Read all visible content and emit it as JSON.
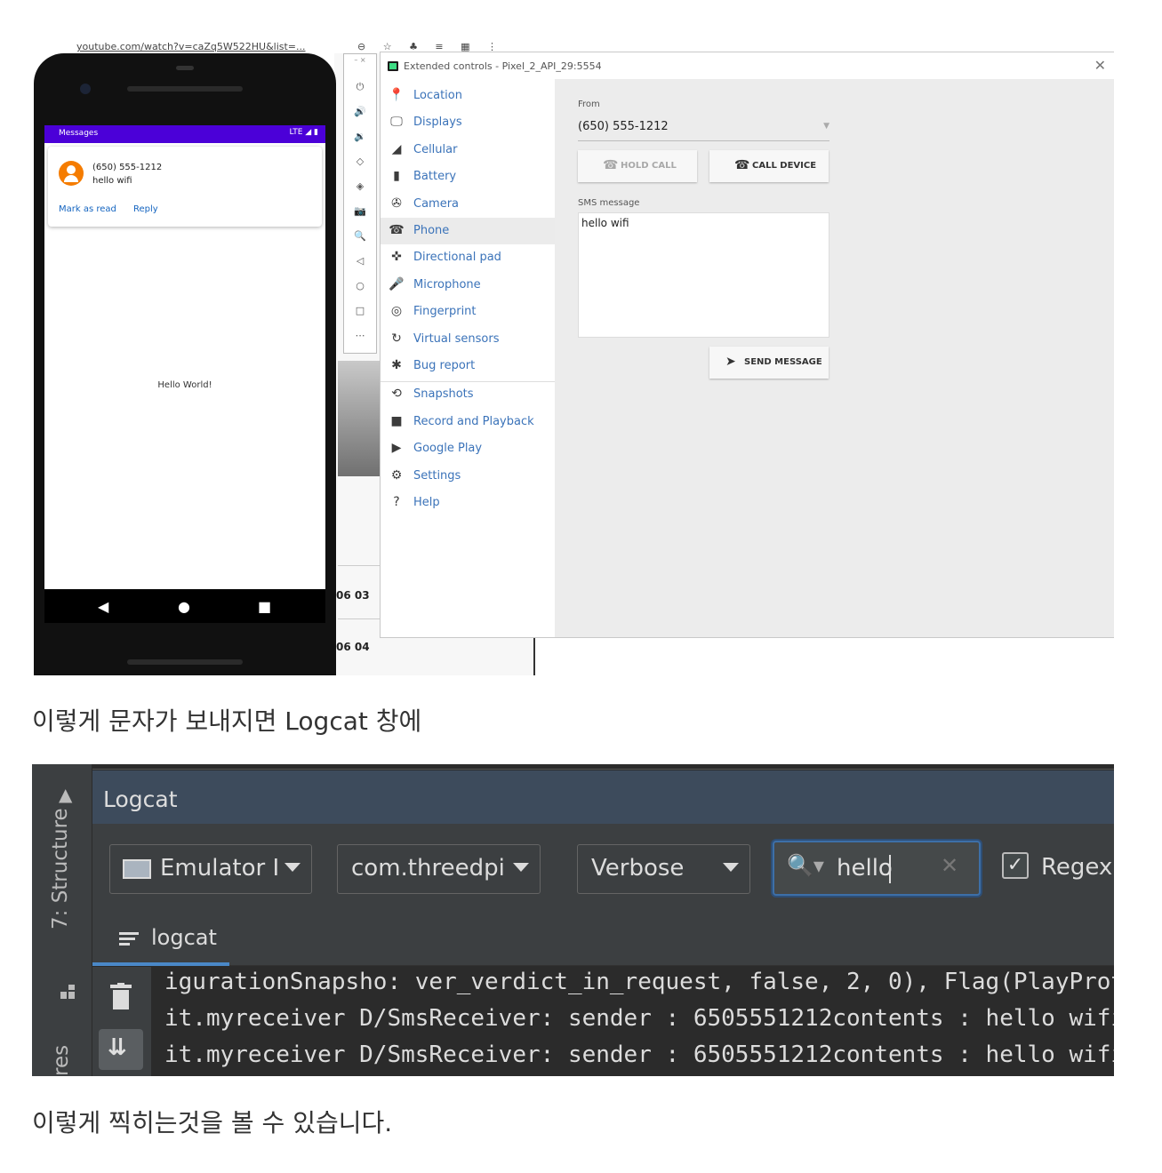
{
  "screenshot1": {
    "browser": {
      "url": "youtube.com/watch?v=caZq5W522HU&list=...",
      "icons": "⊖ ☆ ♣ ≡ ▦ ⋮"
    },
    "phone": {
      "status_app": "Messages",
      "status_right": "LTE ◢ ▮",
      "notification": {
        "sender": "(650) 555-1212",
        "body": "hello wifi",
        "action_mark_read": "Mark as read",
        "action_reply": "Reply"
      },
      "center_text": "Hello World!",
      "nav": {
        "back": "◀",
        "home": "●",
        "recents": "■"
      }
    },
    "side_toolbar": {
      "window_controls": "– ×",
      "icons": [
        "⏻",
        "🔊",
        "🔉",
        "◇",
        "◈",
        "📷",
        "🔍",
        "◁",
        "○",
        "□",
        "⋯"
      ]
    },
    "background": {
      "num1": "06 03",
      "num2": "06 04"
    },
    "extended_controls": {
      "title": "Extended controls - Pixel_2_API_29:5554",
      "close": "✕",
      "nav": [
        {
          "label": "Location",
          "icon": "location-pin-icon",
          "glyph": "📍"
        },
        {
          "label": "Displays",
          "icon": "display-icon",
          "glyph": "🖵"
        },
        {
          "label": "Cellular",
          "icon": "cellular-signal-icon",
          "glyph": "◢"
        },
        {
          "label": "Battery",
          "icon": "battery-icon",
          "glyph": "▮"
        },
        {
          "label": "Camera",
          "icon": "camera-aperture-icon",
          "glyph": "✇"
        },
        {
          "label": "Phone",
          "icon": "phone-icon",
          "glyph": "☎"
        },
        {
          "label": "Directional pad",
          "icon": "dpad-icon",
          "glyph": "✜"
        },
        {
          "label": "Microphone",
          "icon": "microphone-icon",
          "glyph": "🎤"
        },
        {
          "label": "Fingerprint",
          "icon": "fingerprint-icon",
          "glyph": "◎"
        },
        {
          "label": "Virtual sensors",
          "icon": "rotate-sensor-icon",
          "glyph": "↻"
        },
        {
          "label": "Bug report",
          "icon": "bug-icon",
          "glyph": "✱"
        },
        {
          "label": "Snapshots",
          "icon": "history-icon",
          "glyph": "⟲"
        },
        {
          "label": "Record and Playback",
          "icon": "video-camera-icon",
          "glyph": "■"
        },
        {
          "label": "Google Play",
          "icon": "google-play-icon",
          "glyph": "▶"
        },
        {
          "label": "Settings",
          "icon": "gear-icon",
          "glyph": "⚙"
        },
        {
          "label": "Help",
          "icon": "help-icon",
          "glyph": "?"
        }
      ],
      "selected": "Phone",
      "phone_panel": {
        "from_label": "From",
        "from_value": "(650) 555-1212",
        "hold_call": "HOLD CALL",
        "call_device": "CALL DEVICE",
        "sms_label": "SMS message",
        "sms_text": "hello wifi",
        "send_message": "SEND MESSAGE"
      }
    }
  },
  "caption1": "이렇게 문자가 보내지면 Logcat 창에",
  "screenshot2": {
    "side": {
      "structure": "7: Structure",
      "res": "res"
    },
    "title": "Logcat",
    "device": "Emulator I",
    "package": "com.threedpi",
    "level": "Verbose",
    "search": "hello",
    "clear": "✕",
    "regex_label": "Regex",
    "regex_checked": "✓",
    "tab": "logcat",
    "lines": [
      "igurationSnapsho: ver_verdict_in_request, false, 2, 0), Flag(PlayProtect_",
      "it.myreceiver D/SmsReceiver: sender : 6505551212contents : hello wifi",
      "it.myreceiver D/SmsReceiver: sender : 6505551212contents : hello wifi"
    ]
  },
  "caption2": "이렇게 찍히는것을 볼 수 있습니다."
}
